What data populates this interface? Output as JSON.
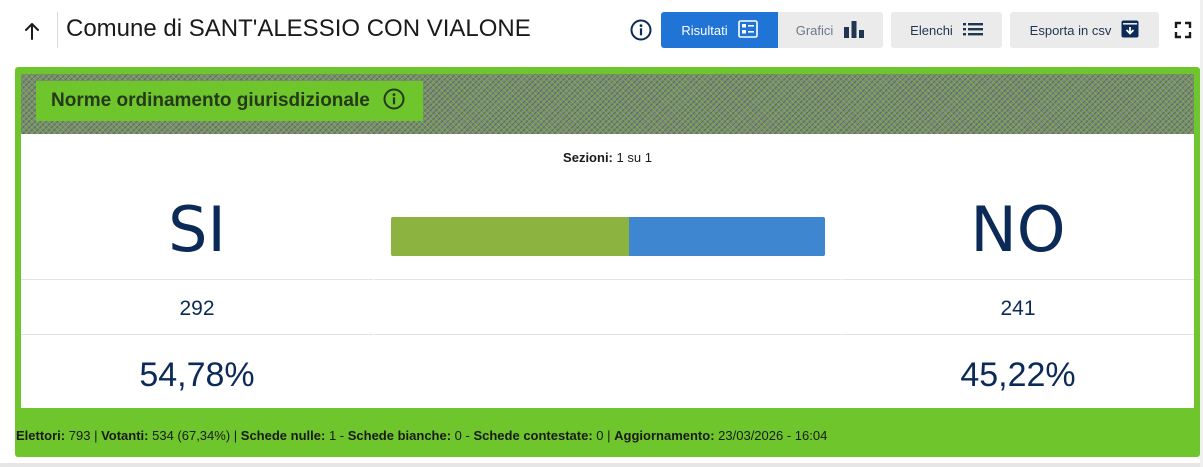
{
  "header": {
    "title": "Comune di SANT'ALESSIO CON VIALONE",
    "tabs": [
      {
        "label": "Risultati",
        "icon": "list-details-icon",
        "active": true
      },
      {
        "label": "Grafici",
        "icon": "bar-chart-icon",
        "active": false
      }
    ],
    "elenchi_label": "Elenchi",
    "csv_label": "Esporta in csv",
    "accent_color": "#1f74d6"
  },
  "card": {
    "title": "Norme ordinamento giurisdizionale",
    "sezioni_label": "Sezioni:",
    "sezioni_value": "1 su 1",
    "si": {
      "label": "SI",
      "count": "292",
      "percent": "54,78%",
      "share": 54.78,
      "color": "#8cb340"
    },
    "no": {
      "label": "NO",
      "count": "241",
      "percent": "45,22%",
      "share": 45.22,
      "color": "#3f86d0"
    },
    "accent_color": "#6fc52c"
  },
  "footer": {
    "elettori_label": "Elettori:",
    "elettori_value": "793",
    "votanti_label": "Votanti:",
    "votanti_value": "534 (67,34%)",
    "nulle_label": "Schede nulle:",
    "nulle_value": "1",
    "bianche_label": "Schede bianche:",
    "bianche_value": "0",
    "contestate_label": "Schede contestate:",
    "contestate_value": "0",
    "aggiornamento_label": "Aggiornamento:",
    "aggiornamento_value": "23/03/2026 - 16:04"
  }
}
